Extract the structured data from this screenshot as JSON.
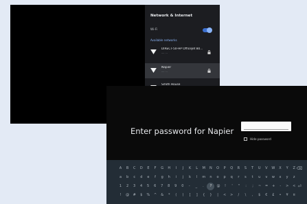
{
  "settings": {
    "title": "Network & Internet",
    "wifi_label": "Wi-Fi",
    "wifi_enabled": true,
    "section_label": "Available networks",
    "networks": [
      {
        "name": "DIRECT-50-HP OfficeJet 80...",
        "detail": "····  ·  ··",
        "locked": true,
        "selected": false
      },
      {
        "name": "Napier",
        "detail": "····  ·  ··",
        "locked": true,
        "selected": true
      },
      {
        "name": "Smith House",
        "detail": "····  ·  ··",
        "locked": true,
        "selected": false
      }
    ]
  },
  "password_dialog": {
    "title": "Enter password for Napier",
    "input_value": "",
    "hide_password_label": "Hide password",
    "hide_password_checked": false
  },
  "keyboard": {
    "rows": [
      [
        "A",
        "B",
        "C",
        "D",
        "E",
        "F",
        "G",
        "H",
        "I",
        "J",
        "K",
        "L",
        "M",
        "N",
        "O",
        "P",
        "Q",
        "R",
        "S",
        "T",
        "U",
        "V",
        "W",
        "X",
        "Y",
        "Z"
      ],
      [
        "a",
        "b",
        "c",
        "d",
        "e",
        "f",
        "g",
        "h",
        "i",
        "j",
        "k",
        "l",
        "m",
        "n",
        "o",
        "p",
        "q",
        "r",
        "s",
        "t",
        "u",
        "v",
        "w",
        "x",
        "y",
        "z"
      ],
      [
        "1",
        "2",
        "3",
        "4",
        "5",
        "6",
        "7",
        "8",
        "9",
        "0",
        "-",
        "_",
        ".",
        "?",
        "@",
        "!",
        "'",
        "\"",
        ":",
        ";",
        "~",
        "=",
        "+",
        "-",
        ">",
        "<"
      ],
      [
        "!",
        "@",
        "#",
        "$",
        "%",
        "^",
        "&",
        "*",
        "(",
        ")",
        "[",
        "]",
        "{",
        "}",
        "|",
        "<",
        ">",
        "/",
        "\\",
        ",",
        "$",
        "€",
        "£",
        "•",
        "¥",
        "¤"
      ]
    ],
    "active_key": "?",
    "side_keys": [
      "⌫",
      "",
      "⏎",
      ""
    ]
  }
}
